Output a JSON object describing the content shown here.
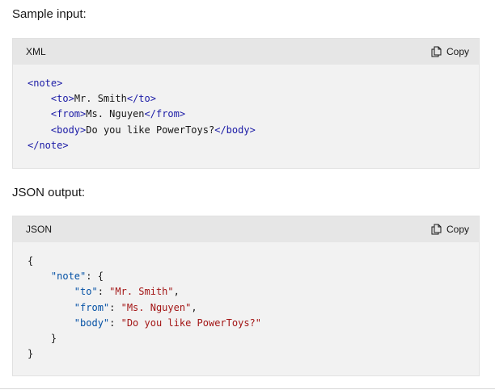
{
  "sections": {
    "input_heading": "Sample input:",
    "output_heading": "JSON output:"
  },
  "xml_block": {
    "language": "XML",
    "copy_label": "Copy",
    "lines": {
      "l1": {
        "open": "<note>"
      },
      "l2": {
        "indent": "    ",
        "open": "<to>",
        "text": "Mr. Smith",
        "close": "</to>"
      },
      "l3": {
        "indent": "    ",
        "open": "<from>",
        "text": "Ms. Nguyen",
        "close": "</from>"
      },
      "l4": {
        "indent": "    ",
        "open": "<body>",
        "text": "Do you like PowerToys?",
        "close": "</body>"
      },
      "l5": {
        "close": "</note>"
      }
    }
  },
  "json_block": {
    "language": "JSON",
    "copy_label": "Copy",
    "lines": {
      "l1": {
        "punct": "{"
      },
      "l2": {
        "indent": "    ",
        "key": "\"note\"",
        "punct": ": {"
      },
      "l3": {
        "indent": "        ",
        "key": "\"to\"",
        "sep": ": ",
        "value": "\"Mr. Smith\"",
        "punct": ","
      },
      "l4": {
        "indent": "        ",
        "key": "\"from\"",
        "sep": ": ",
        "value": "\"Ms. Nguyen\"",
        "punct": ","
      },
      "l5": {
        "indent": "        ",
        "key": "\"body\"",
        "sep": ": ",
        "value": "\"Do you like PowerToys?\""
      },
      "l6": {
        "indent": "    ",
        "punct": "}"
      },
      "l7": {
        "punct": "}"
      }
    }
  }
}
